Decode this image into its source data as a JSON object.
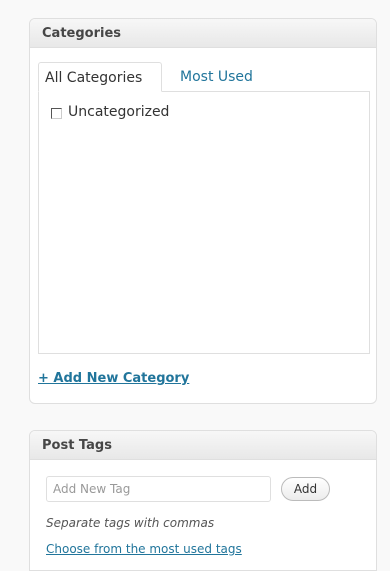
{
  "categories_box": {
    "title": "Categories",
    "tabs": [
      {
        "label": "All Categories",
        "active": true
      },
      {
        "label": "Most Used",
        "active": false
      }
    ],
    "items": [
      {
        "label": "Uncategorized",
        "checked": false
      }
    ],
    "add_new_label": "+ Add New Category"
  },
  "tags_box": {
    "title": "Post Tags",
    "input_placeholder": "Add New Tag",
    "add_button_label": "Add",
    "hint": "Separate tags with commas",
    "choose_link": "Choose from the most used tags"
  },
  "colors": {
    "link": "#21759b",
    "border": "#dfdfdf",
    "header_bg": "#eeeeee",
    "page_bg": "#f9f9f9"
  }
}
